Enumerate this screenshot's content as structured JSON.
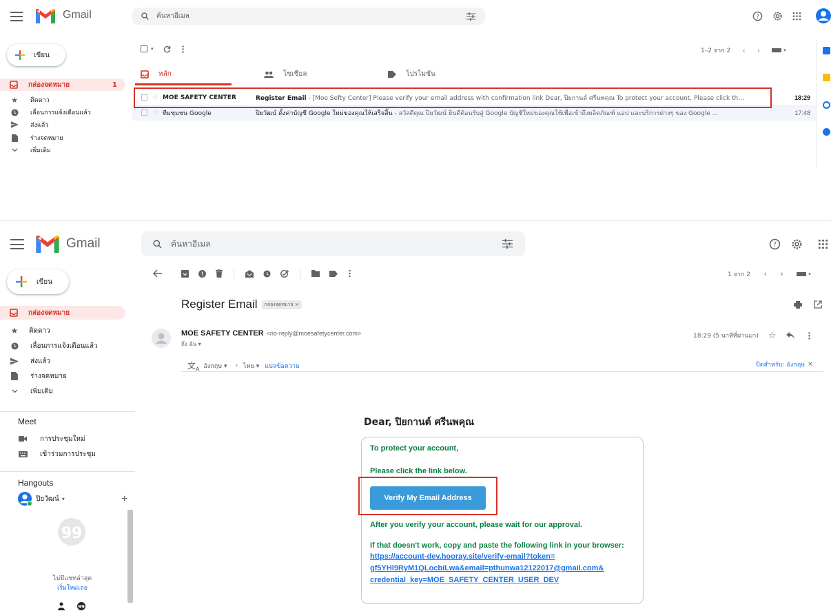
{
  "colors": {
    "accent_red": "#d93025",
    "link_blue": "#1a73e8",
    "green_text": "#0b8043",
    "verify_blue": "#3b9ad9"
  },
  "top": {
    "brand": "Gmail",
    "search_placeholder": "ค้นหาอีเมล",
    "compose": "เขียน",
    "nav": [
      {
        "label": "กล่องจดหมาย",
        "count": "1",
        "icon": "inbox-icon"
      },
      {
        "label": "ติดดาว",
        "icon": "star-icon"
      },
      {
        "label": "เลื่อนการแจ้งเตือนแล้ว",
        "icon": "clock-icon"
      },
      {
        "label": "ส่งแล้ว",
        "icon": "send-icon"
      },
      {
        "label": "ร่างจดหมาย",
        "icon": "draft-icon"
      },
      {
        "label": "เพิ่มเติม",
        "icon": "chevron-down-icon"
      }
    ],
    "pagination": "1–2 จาก 2",
    "tabs": [
      {
        "label": "หลัก",
        "icon": "inbox-icon"
      },
      {
        "label": "โซเชียล",
        "icon": "people-icon"
      },
      {
        "label": "โปรโมชัน",
        "icon": "tag-icon"
      }
    ],
    "emails": [
      {
        "from": "MOE SAFETY CENTER",
        "subject": "Register Email",
        "snippet": " - [Moe Sefty Center] Please verify your email address with confirmation link Dear, ปิยกานต์ ศรีนพคุณ To protect your account, Please click th...",
        "time": "18:29"
      },
      {
        "from": "ทีมชุมชน Google",
        "subject": "ปิยวัฒน์ ตั้งค่าบัญชี Google ใหม่ของคุณให้เสร็จสิ้น",
        "snippet": " - สวัสดีคุณ ปิยวัฒน์ ยินดีต้อนรับสู่ Google บัญชีใหม่ของคุณใช้เพื่อเข้าถึงผลิตภัณฑ์ แอป และบริการต่างๆ ของ Google ...",
        "time": "17:48"
      }
    ]
  },
  "bottom": {
    "brand": "Gmail",
    "search_placeholder": "ค้นหาอีเมล",
    "compose": "เขียน",
    "nav": [
      {
        "label": "กล่องจดหมาย",
        "icon": "inbox-icon"
      },
      {
        "label": "ติดดาว",
        "icon": "star-icon"
      },
      {
        "label": "เลื่อนการแจ้งเตือนแล้ว",
        "icon": "clock-icon"
      },
      {
        "label": "ส่งแล้ว",
        "icon": "send-icon"
      },
      {
        "label": "ร่างจดหมาย",
        "icon": "draft-icon"
      },
      {
        "label": "เพิ่มเติม",
        "icon": "chevron-down-icon"
      }
    ],
    "meet_title": "Meet",
    "meet_items": [
      {
        "label": "การประชุมใหม่",
        "icon": "video-icon"
      },
      {
        "label": "เข้าร่วมการประชุม",
        "icon": "keyboard-icon"
      }
    ],
    "hangouts_title": "Hangouts",
    "hangouts_user": "ปิยวัฒน์",
    "hangouts_empty": "ไม่มีแชทล่าสุด",
    "hangouts_start": "เริ่มใหม่เลย",
    "pagination": "1 จาก 2",
    "subject": "Register Email",
    "label_chip": "กล่องจดหมาย ×",
    "sender_name": "MOE SAFETY CENTER",
    "sender_email": "<no-reply@moesafetycenter.com>",
    "to_line": "ถึง ฉัน ▾",
    "time": "18:29 (5 นาทีที่ผ่านมา)",
    "translate_from": "อังกฤษ ▾",
    "translate_arrow": "›",
    "translate_to": "ไทย ▾",
    "translate_link": "แปลข้อความ",
    "translate_off": "ปิดสำหรับ: อังกฤษ",
    "translate_off_x": "×",
    "greeting": "Dear, ปิยกานต์ ศรีนพคุณ",
    "line1": "To protect your account,",
    "line2": "Please click the link below.",
    "verify_button": "Verify My Email Address",
    "line3": "After you verify your account, please wait for our approval.",
    "line4": "If that doesn't work, copy and paste the following link in your browser:",
    "link_lines": [
      "https://account-dev.hooray.site/verify-email?token=",
      "gf5YHl9RyM1QLocbiLwa&email=pthunwa12122017@gmail.com&",
      "credential_key=MOE_SAFETY_CENTER_USER_DEV"
    ]
  }
}
